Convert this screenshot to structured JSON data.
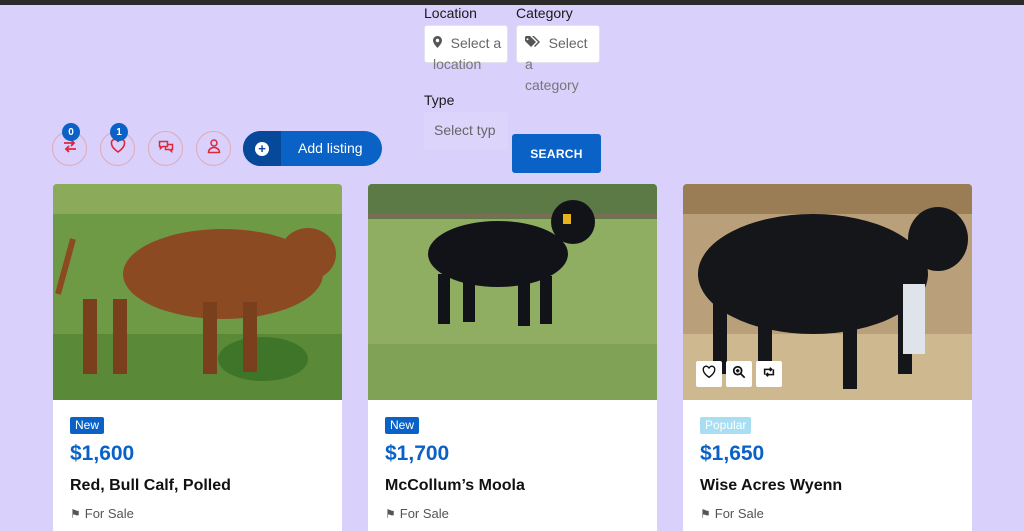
{
  "filters": {
    "location": {
      "label": "Location",
      "placeholder_line1": "Select a",
      "placeholder_line2": "location",
      "icon": "map-pin-icon"
    },
    "category": {
      "label": "Category",
      "placeholder_line1": "Select",
      "placeholder_line2": "a",
      "placeholder_line3": "category",
      "icon": "tags-icon"
    },
    "type": {
      "label": "Type",
      "placeholder": "Select typ"
    },
    "search_label": "SEARCH"
  },
  "toolbar": {
    "compare_count": "0",
    "favorites_count": "1",
    "add_listing_label": "Add listing"
  },
  "listings": [
    {
      "badge": "New",
      "price": "$1,600",
      "title": "Red, Bull Calf, Polled",
      "status": "For Sale"
    },
    {
      "badge": "New",
      "price": "$1,700",
      "title": "McCollum’s Moola",
      "status": "For Sale"
    },
    {
      "badge": "Popular",
      "price": "$1,650",
      "title": "Wise Acres Wyenn",
      "status": "For Sale"
    }
  ],
  "colors": {
    "page_bg": "#d9d0fb",
    "accent": "#0a62c6",
    "icon_red": "#e0263a",
    "badge_popular": "#a7def2"
  }
}
